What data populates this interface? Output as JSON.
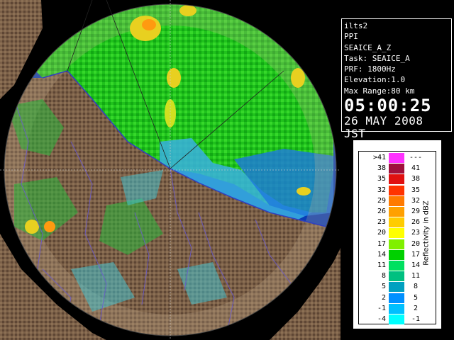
{
  "info": {
    "radar_name": "ilts2",
    "scan_type": "PPI",
    "product": "SEAICE_A_Z",
    "task": "Task: SEAICE_A",
    "prf": "PRF: 1800Hz",
    "elevation": "Elevation:1.0",
    "max_range": "Max Range:80 km",
    "time": "05:00:25",
    "date": "26 MAY 2008 JST"
  },
  "legend": {
    "title": "Reflectivity in dBZ",
    "rows": [
      {
        "low": ">41",
        "high": "---",
        "color": "#ff33ff"
      },
      {
        "low": "38",
        "high": "41",
        "color": "#a0103c"
      },
      {
        "low": "35",
        "high": "38",
        "color": "#e01010"
      },
      {
        "low": "32",
        "high": "35",
        "color": "#ff3300"
      },
      {
        "low": "29",
        "high": "32",
        "color": "#ff7a00"
      },
      {
        "low": "26",
        "high": "29",
        "color": "#ffa000"
      },
      {
        "low": "23",
        "high": "26",
        "color": "#ffcc00"
      },
      {
        "low": "20",
        "high": "23",
        "color": "#ffff00"
      },
      {
        "low": "17",
        "high": "20",
        "color": "#80f000"
      },
      {
        "low": "14",
        "high": "17",
        "color": "#00d000"
      },
      {
        "low": "11",
        "high": "14",
        "color": "#00e060"
      },
      {
        "low": "8",
        "high": "11",
        "color": "#00c080"
      },
      {
        "low": "5",
        "high": "8",
        "color": "#00a0c0"
      },
      {
        "low": "2",
        "high": "5",
        "color": "#0090ff"
      },
      {
        "low": "-1",
        "high": "2",
        "color": "#00c0ff"
      },
      {
        "low": "-4",
        "high": "-1",
        "color": "#00ffff"
      }
    ]
  },
  "colors": {
    "sea": "#0a3cb4",
    "land": "#7b6048",
    "terrain_dark": "#4b3a2a",
    "echo_green": "#22c81e",
    "echo_cyan": "#3ad0e0",
    "echo_yellow": "#e8e020",
    "background": "#000000"
  }
}
